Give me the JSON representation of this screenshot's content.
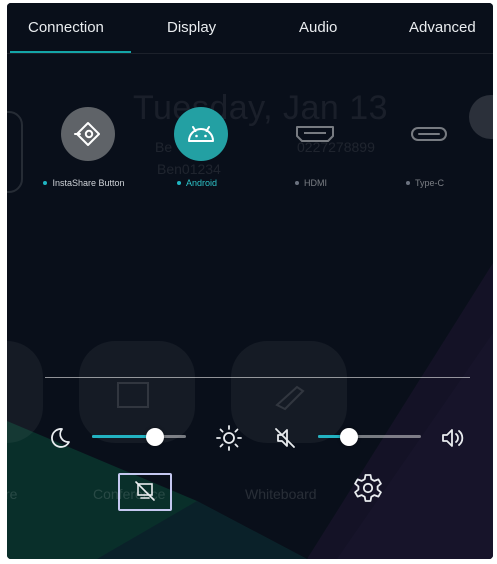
{
  "tabs": [
    {
      "label": "Connection",
      "active": true
    },
    {
      "label": "Display",
      "active": false
    },
    {
      "label": "Audio",
      "active": false
    },
    {
      "label": "Advanced",
      "active": false
    }
  ],
  "background": {
    "date": "Tuesday, Jan 13",
    "wifi_name": "Be",
    "user_name": "Ben01234",
    "location_code": "0227278899",
    "app_labels": [
      "re",
      "Conference",
      "Whiteboard"
    ]
  },
  "sources": [
    {
      "label": "InstaShare Button",
      "icon": "cast-target-icon",
      "active": true,
      "dot_color": "#1fb5c2"
    },
    {
      "label": "Android",
      "icon": "android-icon",
      "active": true,
      "dot_color": "#1fb5c2",
      "label_color": "#2ec4c9"
    },
    {
      "label": "HDMI",
      "icon": "hdmi-port-icon",
      "active": false,
      "dot_color": "#6b7280"
    },
    {
      "label": "Type-C",
      "icon": "type-c-port-icon",
      "active": false,
      "dot_color": "#6b7280"
    }
  ],
  "controls": {
    "brightness_level": 0.67,
    "volume_level": 0.3,
    "icons": {
      "brightness_min": "moon-icon",
      "brightness_max": "sun-icon",
      "volume_min": "mute-icon",
      "volume_max": "speaker-icon",
      "screen_off": "screen-off-icon",
      "settings": "gear-icon"
    }
  },
  "colors": {
    "accent": "#14a5a8",
    "slider_fill": "#22b3c2",
    "android_circle": "#23a0a3",
    "instashare_circle": "#5f6368"
  }
}
